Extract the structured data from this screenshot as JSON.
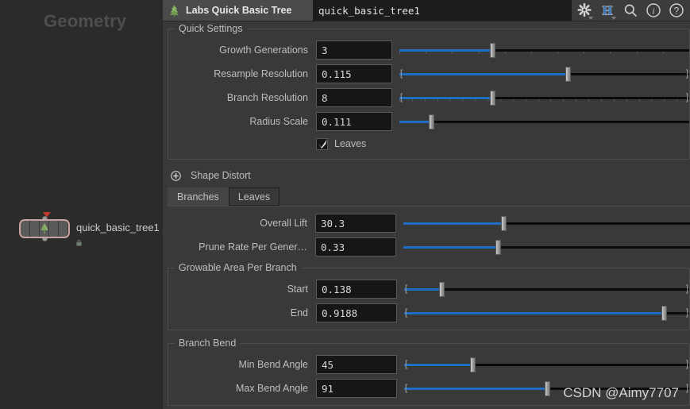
{
  "network": {
    "title": "Geometry",
    "node": {
      "label": "quick_basic_tree1",
      "icon": "tree-node-icon",
      "flag": "display-flag",
      "lock": "lock-icon"
    }
  },
  "header": {
    "icon": "labs-tree-icon",
    "title": "Labs Quick Basic Tree",
    "path": "quick_basic_tree1",
    "icons": [
      {
        "name": "gear-icon",
        "glyph": "gear"
      },
      {
        "name": "houdini-h-icon",
        "glyph": "H"
      },
      {
        "name": "search-icon",
        "glyph": "search"
      },
      {
        "name": "info-icon",
        "glyph": "info"
      },
      {
        "name": "help-icon",
        "glyph": "help"
      }
    ]
  },
  "quick_settings": {
    "title": "Quick Settings",
    "params": [
      {
        "label": "Growth Generations",
        "value": "3",
        "fill": 32,
        "handle": 32,
        "ticks": 11,
        "brackets": false
      },
      {
        "label": "Resample Resolution",
        "value": "0.115",
        "fill": 58,
        "handle": 58,
        "ticks": 0,
        "brackets": true
      },
      {
        "label": "Branch Resolution",
        "value": "8",
        "fill": 32,
        "handle": 32,
        "ticks": 23,
        "brackets": true
      },
      {
        "label": "Radius Scale",
        "value": "0.111",
        "fill": 11,
        "handle": 11,
        "ticks": 0,
        "brackets": false
      }
    ],
    "checkbox": {
      "label": "Leaves",
      "checked": true
    }
  },
  "shape_distort": {
    "label": "Shape Distort",
    "expanded": false
  },
  "tabs": [
    {
      "label": "Branches",
      "active": true
    },
    {
      "label": "Leaves",
      "active": false
    }
  ],
  "branches": {
    "params": [
      {
        "label": "Overall Lift",
        "value": "30.3",
        "fill": 35,
        "handle": 35,
        "ticks": 0,
        "brackets": false
      },
      {
        "label": "Prune Rate Per Gener…",
        "value": "0.33",
        "fill": 33,
        "handle": 33,
        "ticks": 0,
        "brackets": false
      }
    ],
    "growable": {
      "title": "Growable Area Per Branch",
      "params": [
        {
          "label": "Start",
          "value": "0.138",
          "fill": 13,
          "handle": 13,
          "ticks": 0,
          "brackets": true
        },
        {
          "label": "End",
          "value": "0.9188",
          "fill": 91,
          "handle": 91,
          "ticks": 0,
          "brackets": true
        }
      ]
    },
    "branch_bend": {
      "title": "Branch Bend",
      "params": [
        {
          "label": "Min Bend Angle",
          "value": "45",
          "fill": 24,
          "handle": 24,
          "ticks": 0,
          "brackets": true
        },
        {
          "label": "Max Bend Angle",
          "value": "91",
          "fill": 50,
          "handle": 50,
          "ticks": 0,
          "brackets": true
        }
      ]
    }
  },
  "watermark": "CSDN @Aimy7707"
}
